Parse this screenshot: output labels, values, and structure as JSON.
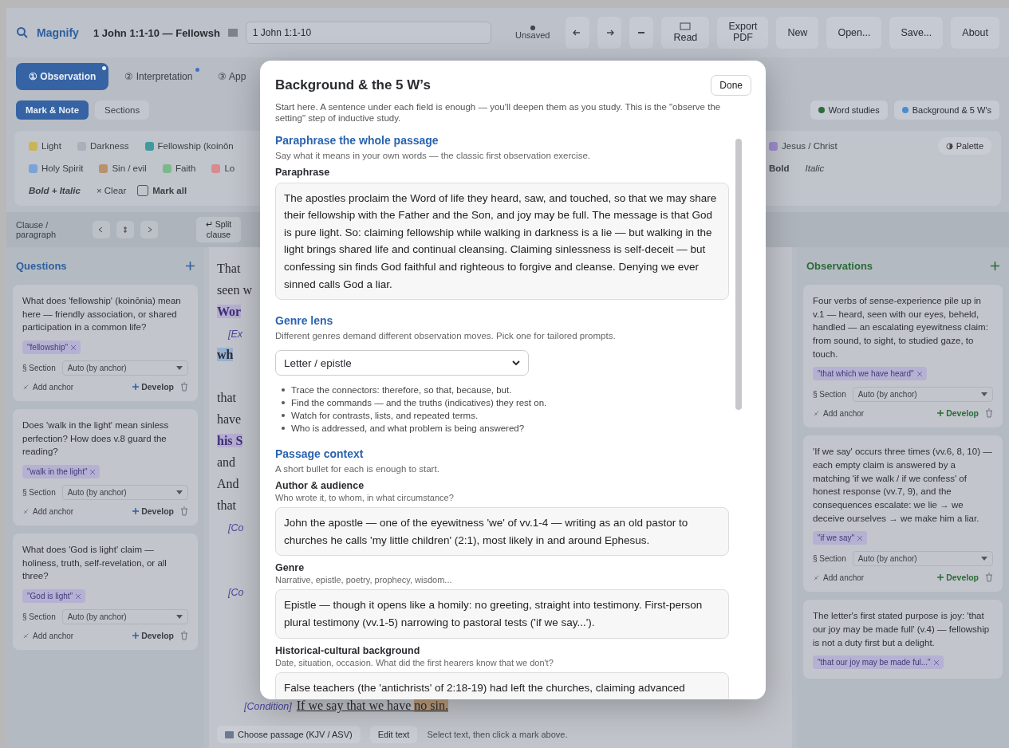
{
  "toolbar": {
    "app_name": "Magnify",
    "doc_title": "1 John 1:1-10 — Fellowsh",
    "passage": "1 John 1:1-10",
    "save_status": "Unsaved",
    "read_label": "Read",
    "buttons": [
      "Export PDF",
      "New",
      "Open...",
      "Save...",
      "About"
    ]
  },
  "phase_tabs": [
    {
      "label": "① Observation",
      "selected": true,
      "dot": true
    },
    {
      "label": "② Interpretation",
      "selected": false,
      "dot": true
    },
    {
      "label": "③ App",
      "selected": false,
      "dot": false
    }
  ],
  "modes": [
    {
      "label": "Mark & Note",
      "selected": true
    },
    {
      "label": "Sections",
      "selected": false
    }
  ],
  "panel_buttons": [
    {
      "label": "Word studies",
      "color": "#2f6b3a"
    },
    {
      "label": "Background & 5 W's",
      "color": "#4a8ccf"
    }
  ],
  "marks_left": [
    [
      {
        "label": "Light",
        "color": "#c9b45a"
      },
      {
        "label": "Darkness",
        "color": "#a9b0ba"
      },
      {
        "label": "Fellowship (koinōn",
        "color": "#3f9a9e"
      }
    ],
    [
      {
        "label": "Holy Spirit",
        "color": "#7aa3d8"
      },
      {
        "label": "Sin / evil",
        "color": "#b8926a"
      },
      {
        "label": "Faith",
        "color": "#7db88a"
      },
      {
        "label": "Lo",
        "color": "#d88a8e"
      }
    ]
  ],
  "marks_right": [
    {
      "label": "Jesus / Christ",
      "color": "#9d8ccc"
    }
  ],
  "palette_label": "Palette",
  "styles": [
    "Bold + Italic",
    "Bold",
    "Italic"
  ],
  "clear_label": "× Clear",
  "mark_all": {
    "label": "Mark all",
    "checked": false
  },
  "clause_bar": {
    "label": "Clause / paragraph",
    "split_label": "↵ Split clause"
  },
  "questions": {
    "title": "Questions",
    "cards": [
      {
        "text": "What does 'fellowship' (koinōnia) mean here — friendly association, or shared participation in a common life?",
        "anchor": "\"fellowship\"",
        "section_label": "§ Section",
        "section_value": "Auto (by anchor)",
        "add_anchor_label": "Add anchor",
        "develop_label": "Develop"
      },
      {
        "text": "Does 'walk in the light' mean sinless perfection? How does v.8 guard the reading?",
        "anchor": "\"walk in the light\"",
        "section_label": "§ Section",
        "section_value": "Auto (by anchor)",
        "add_anchor_label": "Add anchor",
        "develop_label": "Develop"
      },
      {
        "text": "What does 'God is light' claim — holiness, truth, self-revelation, or all three?",
        "anchor": "\"God is light\"",
        "section_label": "§ Section",
        "section_value": "Auto (by anchor)",
        "add_anchor_label": "Add anchor",
        "develop_label": "Develop"
      }
    ]
  },
  "observations": {
    "title": "Observations",
    "cards": [
      {
        "text": "Four verbs of sense-experience pile up in v.1 — heard, seen with our eyes, beheld, handled — an escalating eyewitness claim: from sound, to sight, to studied gaze, to touch.",
        "anchor": "\"that which we have heard\"",
        "section_label": "§ Section",
        "section_value": "Auto (by anchor)",
        "add_anchor_label": "Add anchor",
        "develop_label": "Develop"
      },
      {
        "text": "'If we say' occurs three times (vv.6, 8, 10) — each empty claim is answered by a matching 'if we walk / if we confess' of honest response (vv.7, 9), and the consequences escalate: we lie → we deceive ourselves → we make him a liar.",
        "anchor": "\"if we say\"",
        "section_label": "§ Section",
        "section_value": "Auto (by anchor)",
        "add_anchor_label": "Add anchor",
        "develop_label": "Develop"
      },
      {
        "text": "The letter's first stated purpose is joy: 'that our joy may be made full' (v.4) — fellowship is not a duty first but a delight.",
        "anchor": "\"that our joy may be made ful...\""
      }
    ]
  },
  "scripture": [
    {
      "kind": "verse",
      "text": "That"
    },
    {
      "kind": "text",
      "text": "seen w"
    },
    {
      "kind": "mark",
      "text": "Wor"
    },
    {
      "kind": "tag",
      "text": "[Ex"
    },
    {
      "kind": "hl",
      "text": "wh"
    },
    {
      "kind": "gap"
    },
    {
      "kind": "verse",
      "text": "that"
    },
    {
      "kind": "text",
      "text": "have"
    },
    {
      "kind": "mark",
      "text": "his S"
    },
    {
      "kind": "verse",
      "text": "and"
    },
    {
      "kind": "verse",
      "text": "And"
    },
    {
      "kind": "text",
      "text": "that"
    },
    {
      "kind": "tag",
      "text": "[Co"
    },
    {
      "kind": "gap"
    },
    {
      "kind": "gap"
    },
    {
      "kind": "tag",
      "text": "[Co"
    }
  ],
  "last_line": {
    "tag": "[Condition]",
    "text": "If we say that we have",
    "marked": "no sin."
  },
  "bottom_bar": {
    "choose_label": "Choose passage (KJV / ASV)",
    "edit_label": "Edit text",
    "hint": "Select text, then click a mark above."
  },
  "modal": {
    "title": "Background & the 5 W’s",
    "done_label": "Done",
    "intro": "Start here. A sentence under each field is enough — you'll deepen them as you study. This is the \"observe the setting\" step of inductive study.",
    "sections": [
      {
        "heading": "Paraphrase the whole passage",
        "hint": "Say what it means in your own words — the classic first observation exercise.",
        "fields": [
          {
            "label": "Paraphrase",
            "value": "The apostles proclaim the Word of life they heard, saw, and touched, so that we may share their fellowship with the Father and the Son, and joy may be full. The message is that God is pure light. So: claiming fellowship while walking in darkness is a lie — but walking in the light brings shared life and continual cleansing. Claiming sinlessness is self-deceit — but confessing sin finds God faithful and righteous to forgive and cleanse. Denying we ever sinned calls God a liar."
          }
        ]
      },
      {
        "heading": "Genre lens",
        "hint": "Different genres demand different observation moves. Pick one for tailored prompts.",
        "select": "Letter / epistle",
        "prompts": [
          "Trace the connectors: therefore, so that, because, but.",
          "Find the commands — and the truths (indicatives) they rest on.",
          "Watch for contrasts, lists, and repeated terms.",
          "Who is addressed, and what problem is being answered?"
        ]
      },
      {
        "heading": "Passage context",
        "hint": "A short bullet for each is enough to start.",
        "fields": [
          {
            "label": "Author & audience",
            "hint": "Who wrote it, to whom, in what circumstance?",
            "value": "John the apostle — one of the eyewitness 'we' of vv.1-4 — writing as an old pastor to churches he calls 'my little children' (2:1), most likely in and around Ephesus."
          },
          {
            "label": "Genre",
            "hint": "Narrative, epistle, poetry, prophecy, wisdom...",
            "value": "Epistle — though it opens like a homily: no greeting, straight into testimony. First-person plural testimony (vv.1-5) narrowing to pastoral tests ('if we say...')."
          },
          {
            "label": "Historical-cultural background",
            "hint": "Date, situation, occasion. What did the first hearers know that we don't?",
            "value": "False teachers (the 'antichrists' of 2:18-19) had left the churches, claiming advanced"
          }
        ]
      }
    ]
  }
}
